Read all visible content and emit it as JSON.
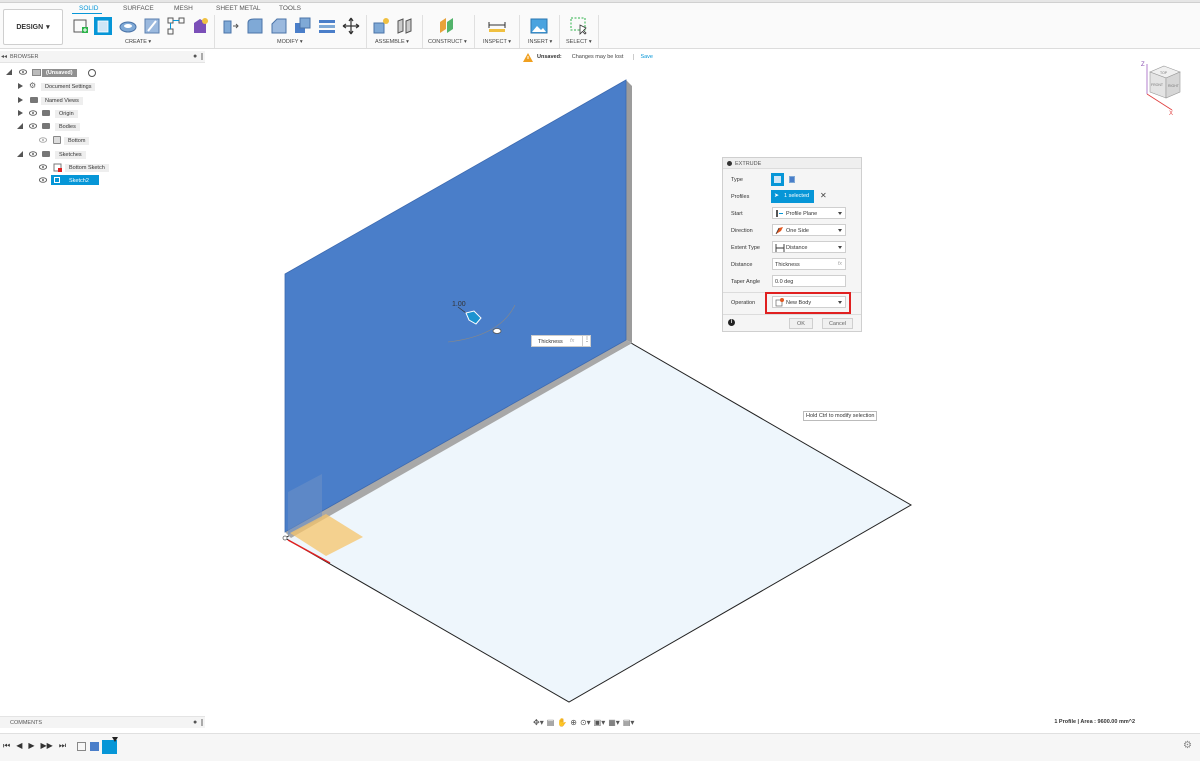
{
  "workspace": {
    "label": "DESIGN"
  },
  "tabs": [
    "SOLID",
    "SURFACE",
    "MESH",
    "SHEET METAL",
    "TOOLS"
  ],
  "groups": {
    "create": "CREATE",
    "modify": "MODIFY",
    "assemble": "ASSEMBLE",
    "construct": "CONSTRUCT",
    "inspect": "INSPECT",
    "insert": "INSERT",
    "select": "SELECT"
  },
  "browser": {
    "title": "BROWSER",
    "root": "(Unsaved)",
    "items": [
      "Document Settings",
      "Named Views",
      "Origin",
      "Bodies",
      "Bottom",
      "Sketches",
      "Bottom Sketch",
      "Sketch2"
    ]
  },
  "unsaved_bar": {
    "label": "Unsaved:",
    "message": "Changes may be lost",
    "save": "Save"
  },
  "extrude": {
    "title": "EXTRUDE",
    "labels": {
      "type": "Type",
      "profiles": "Profiles",
      "start": "Start",
      "direction": "Direction",
      "extent_type": "Extent Type",
      "distance": "Distance",
      "taper_angle": "Taper Angle",
      "operation": "Operation"
    },
    "profiles_value": "1 selected",
    "start_value": "Profile Plane",
    "direction_value": "One Side",
    "extent_value": "Distance",
    "distance_value": "Thickness",
    "fx": "fx",
    "taper_value": "0.0 deg",
    "operation_value": "New Body",
    "ok": "OK",
    "cancel": "Cancel"
  },
  "viewport": {
    "manip_value": "1.00",
    "thickness_input": "Thickness",
    "tooltip": "Hold Ctrl to modify selection",
    "viewcube": {
      "front": "FRONT",
      "right": "RIGHT",
      "top": "TOP",
      "axis_z": "Z",
      "axis_x": "X"
    }
  },
  "comments": {
    "title": "COMMENTS"
  },
  "status": {
    "text": "1 Profile | Area : 9600.00 mm^2"
  },
  "colors": {
    "accent": "#0696d7",
    "body_blue": "#4a7ec9",
    "highlight_red": "#e02020",
    "sheet_fill": "#eef6fc"
  }
}
